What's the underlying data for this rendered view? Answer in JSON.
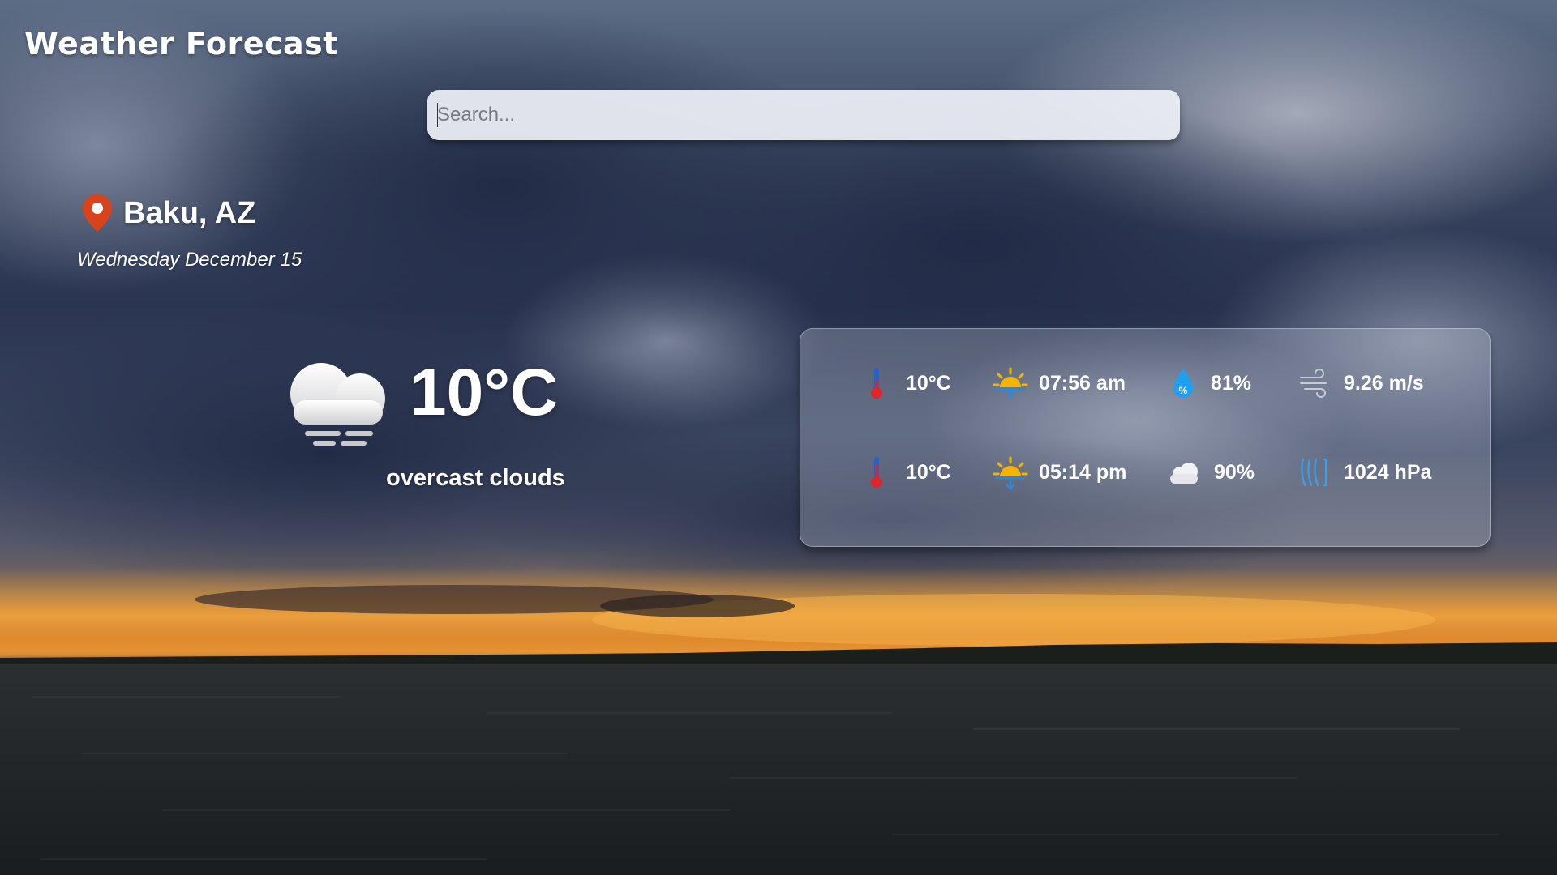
{
  "app": {
    "title": "Weather Forecast"
  },
  "search": {
    "placeholder": "Search...",
    "value": ""
  },
  "location": {
    "city": "Baku, AZ",
    "date": "Wednesday December 15",
    "pin_icon": "map-pin-icon",
    "pin_color": "#d8431c"
  },
  "current": {
    "icon": "cloud-fog-icon",
    "temperature": "10°C",
    "condition": "overcast clouds"
  },
  "details": {
    "row1": [
      {
        "icon": "thermometer-icon",
        "value": "10°C"
      },
      {
        "icon": "sunrise-icon",
        "value": "07:56 am"
      },
      {
        "icon": "humidity-drop-icon",
        "value": "81%"
      },
      {
        "icon": "wind-icon",
        "value": "9.26 m/s"
      }
    ],
    "row2": [
      {
        "icon": "thermometer-icon",
        "value": "10°C"
      },
      {
        "icon": "sunset-icon",
        "value": "05:14 pm"
      },
      {
        "icon": "cloud-icon",
        "value": "90%"
      },
      {
        "icon": "pressure-icon",
        "value": "1024 hPa"
      }
    ]
  },
  "colors": {
    "sun": "#f5b400",
    "sun_arrow": "#2e88d8",
    "drop": "#1ea0f0",
    "thermo_bulb": "#e0262a",
    "thermo_tube": "#2563c8",
    "pressure": "#3aa0e8"
  }
}
